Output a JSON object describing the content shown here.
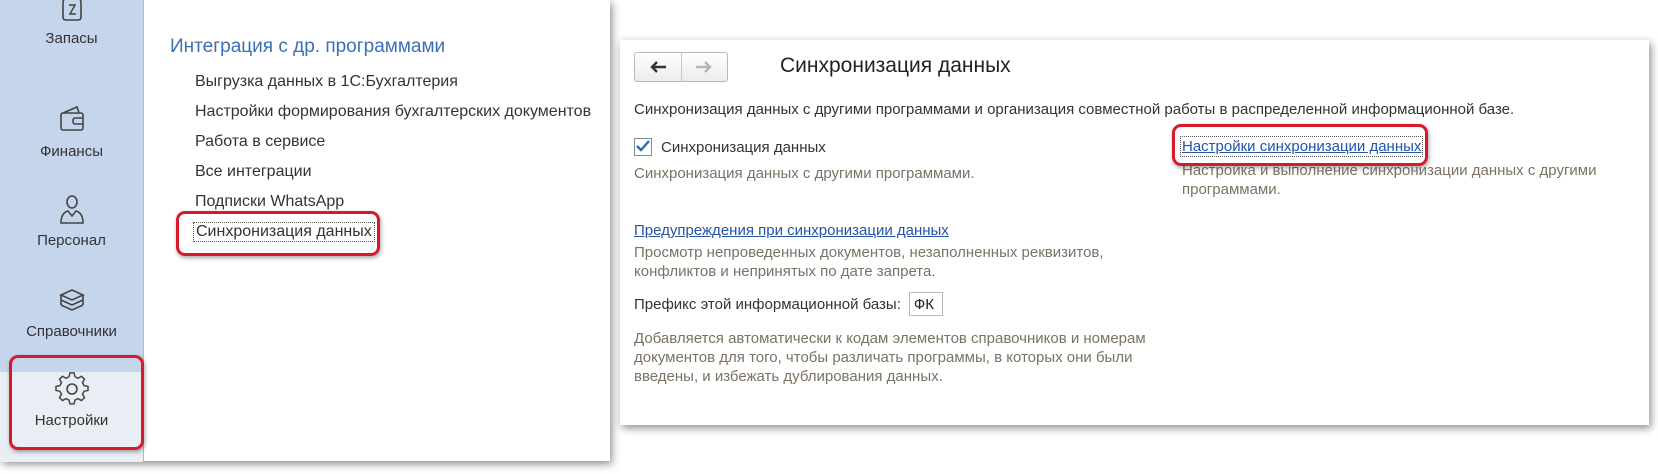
{
  "sidebar": {
    "items": [
      {
        "label": "Запасы",
        "icon": "stock-jar-icon"
      },
      {
        "label": "Финансы",
        "icon": "wallet-icon"
      },
      {
        "label": "Персонал",
        "icon": "person-icon"
      },
      {
        "label": "Справочники",
        "icon": "books-stack-icon"
      },
      {
        "label": "Настройки",
        "icon": "gear-icon"
      }
    ]
  },
  "menu": {
    "section_title": "Интеграция с др. программами",
    "items": [
      "Выгрузка данных в 1С:Бухгалтерия",
      "Настройки формирования бухгалтерских документов",
      "Работа в сервисе",
      "Все интеграции",
      "Подписки WhatsApp",
      "Синхронизация данных"
    ]
  },
  "form": {
    "title": "Синхронизация данных",
    "description": "Синхронизация данных с другими программами и организация совместной работы в распределенной информационной базе.",
    "sync_checkbox": {
      "label": "Синхронизация данных",
      "checked": true
    },
    "sync_hint": "Синхронизация данных с другими программами.",
    "settings_link": "Настройки синхронизации данных",
    "settings_hint": "Настройка и выполнение синхронизации данных с другими программами.",
    "warnings_link": "Предупреждения при синхронизации данных",
    "warnings_hint": "Просмотр непроведенных документов, незаполненных реквизитов, конфликтов и непринятых по дате запрета.",
    "prefix_label": "Префикс этой информационной базы:",
    "prefix_value": "ФК",
    "prefix_hint": "Добавляется автоматически к кодам элементов справочников и номерам документов для того, чтобы различать программы, в которых они были введены, и избежать дублирования данных."
  },
  "colors": {
    "sidebar_bg": "#c5d5ec",
    "highlight_red": "#d8192a",
    "section_title_blue": "#3d6fb7",
    "link_blue": "#2354a6",
    "hint_text": "#7a7264",
    "checkbox_check": "#2b6bb5"
  }
}
